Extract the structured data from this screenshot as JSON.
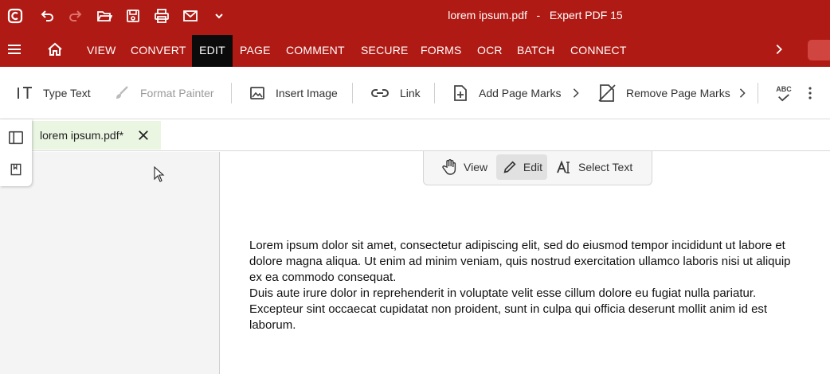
{
  "window": {
    "title": "lorem ipsum.pdf   -   Expert PDF 15"
  },
  "quick_access": [
    {
      "name": "app-logo-icon"
    },
    {
      "name": "undo-icon"
    },
    {
      "name": "redo-icon"
    },
    {
      "name": "open-folder-icon"
    },
    {
      "name": "save-icon"
    },
    {
      "name": "print-icon"
    },
    {
      "name": "email-icon"
    },
    {
      "name": "chevron-down-icon"
    }
  ],
  "ribbon": {
    "tabs": [
      {
        "label": "VIEW"
      },
      {
        "label": "CONVERT"
      },
      {
        "label": "EDIT",
        "active": true
      },
      {
        "label": "PAGE"
      },
      {
        "label": "COMMENT"
      },
      {
        "label": "SECURE"
      },
      {
        "label": "FORMS"
      },
      {
        "label": "OCR"
      },
      {
        "label": "BATCH"
      },
      {
        "label": "CONNECT"
      }
    ]
  },
  "toolbar": {
    "type_text": "Type Text",
    "format_painter": "Format Painter",
    "insert_image": "Insert Image",
    "link": "Link",
    "add_page_marks": "Add Page Marks",
    "remove_page_marks": "Remove Page Marks",
    "spellcheck_icon_text": "ABC"
  },
  "document_tab": {
    "label": "lorem ipsum.pdf*"
  },
  "modes": {
    "view": "View",
    "edit": "Edit",
    "select_text": "Select Text"
  },
  "page": {
    "lines": [
      "Lorem ipsum dolor sit amet, consectetur adipiscing elit, sed do eiusmod tempor incididunt ut labore et",
      "dolore magna aliqua. Ut enim ad minim veniam, quis nostrud exercitation ullamco laboris nisi ut aliquip",
      "ex ea commodo consequat.",
      "Duis aute irure dolor in reprehenderit in voluptate velit esse cillum dolore eu fugiat nulla pariatur.",
      "Excepteur sint occaecat cupidatat non proident, sunt in culpa qui officia deserunt mollit anim id est",
      "laborum."
    ]
  },
  "colors": {
    "brand_red": "#b01a14",
    "active_tab": "#0b0b0b",
    "doc_tab_bg": "#eaf5e2"
  }
}
